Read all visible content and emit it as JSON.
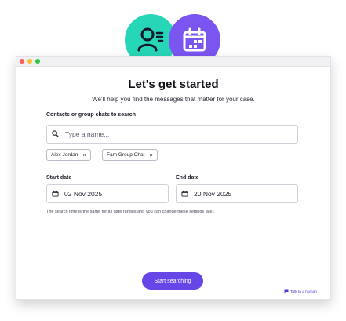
{
  "title": "Let's get started",
  "subtitle": "We'll help you find the messages that matter for your case.",
  "contacts": {
    "label": "Contacts or group chats to search",
    "placeholder": "Type a name...",
    "chips": [
      "Alex Jordan",
      "Fam Group Chat"
    ]
  },
  "start_date": {
    "label": "Start date",
    "value": "02 Nov 2025"
  },
  "end_date": {
    "label": "End date",
    "value": "20 Nov 2025"
  },
  "hint": "The search time is the same for all date ranges and you can change these settings later.",
  "cta": "Start searching",
  "talk": "Talk to a human",
  "icons": {
    "hero_left": "contacts-icon",
    "hero_right": "calendar-icon",
    "search": "search-icon",
    "date": "calendar-icon",
    "remove": "close-icon",
    "chat": "chat-icon"
  },
  "colors": {
    "teal": "#27d6b6",
    "purple": "#7a55f0",
    "button": "#6646e6"
  }
}
